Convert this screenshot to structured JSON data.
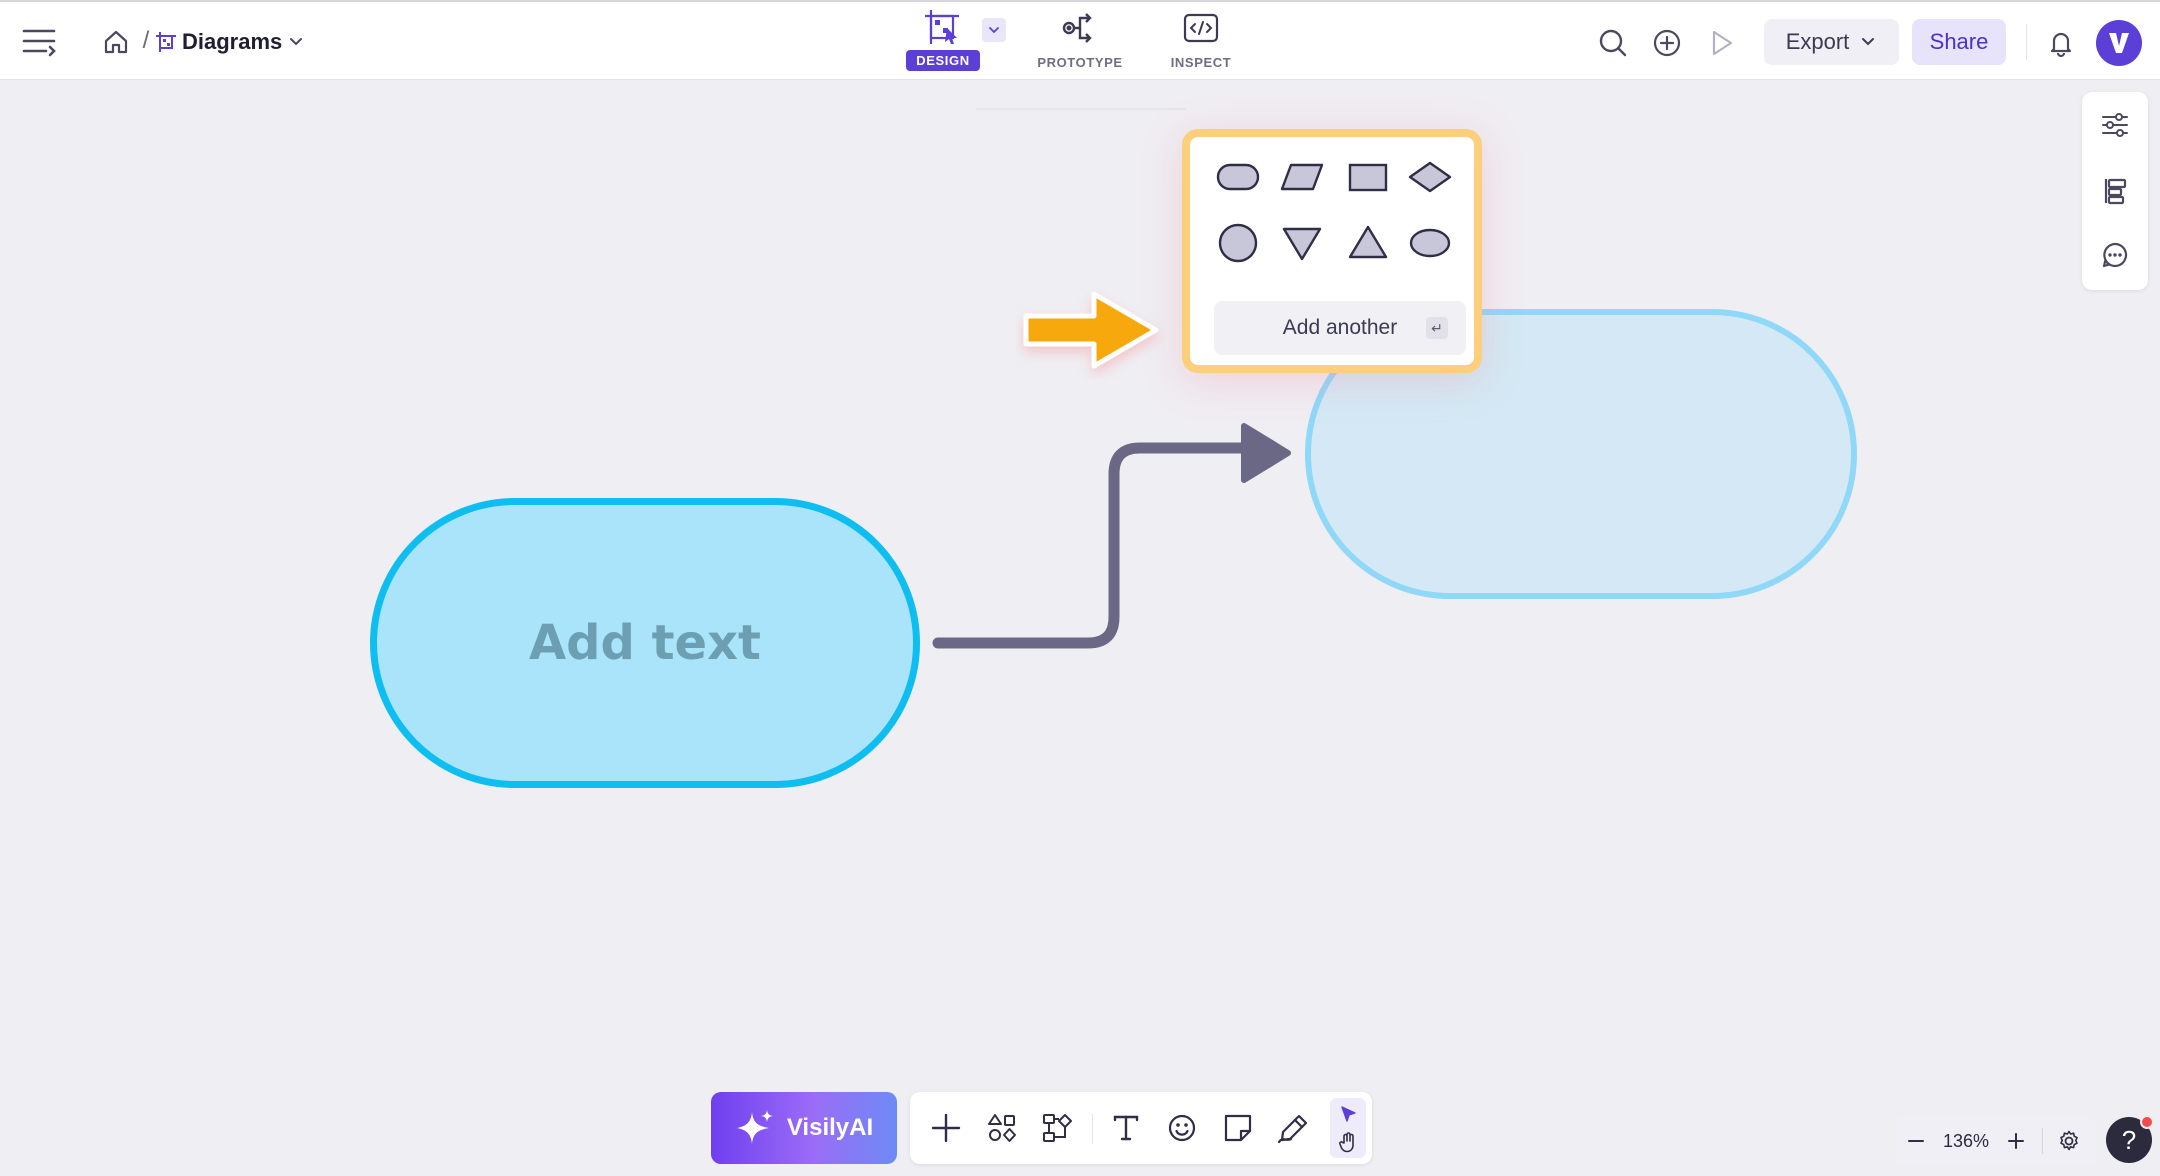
{
  "header": {
    "breadcrumb_sep": "/",
    "doc_title": "Diagrams",
    "modes": [
      {
        "label": "DESIGN",
        "active": true
      },
      {
        "label": "PROTOTYPE",
        "active": false
      },
      {
        "label": "INSPECT",
        "active": false
      }
    ],
    "export_label": "Export",
    "share_label": "Share",
    "avatar_letter": "V"
  },
  "colors": {
    "brand": "#5b3fd6",
    "shape_fill": "#a9e4fb",
    "shape_stroke": "#0fbef0",
    "connector": "#6b6885",
    "highlight_border": "#fccf7c",
    "pointer_arrow": "#f7a80f"
  },
  "canvas": {
    "shape_a_text": "Add text"
  },
  "shape_picker": {
    "options": [
      "terminator",
      "parallelogram",
      "rectangle",
      "diamond",
      "circle",
      "triangle-down",
      "triangle-up",
      "ellipse"
    ],
    "add_another_label": "Add another",
    "enter_key_glyph": "↵"
  },
  "bottom_toolbar": {
    "ai_label": "VisilyAI",
    "tools": [
      "add-icon",
      "components-icon",
      "flow-icon",
      "text-icon",
      "emoji-icon",
      "sticky-note-icon",
      "pen-icon",
      "select-icon",
      "hand-icon"
    ]
  },
  "zoom": {
    "level": "136%"
  },
  "help": {
    "label": "?"
  }
}
